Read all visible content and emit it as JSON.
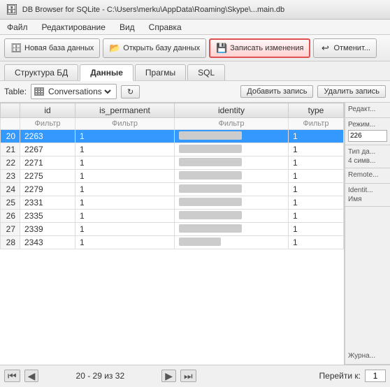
{
  "titlebar": {
    "icon": "🗄",
    "text": "DB Browser for SQLite - C:\\Users\\merku\\AppData\\Roaming\\Skype\\...main.db"
  },
  "menubar": {
    "items": [
      "Файл",
      "Редактирование",
      "Вид",
      "Справка"
    ]
  },
  "toolbar": {
    "new_db": "Новая база данных",
    "open_db": "Открыть базу данных",
    "write_changes": "Записать изменения",
    "cancel": "Отменит..."
  },
  "tabs": [
    "Структура БД",
    "Данные",
    "Прагмы",
    "SQL"
  ],
  "active_tab": 1,
  "table_controls": {
    "label": "Table:",
    "selected_table": "Conversations",
    "refresh_btn": "↻",
    "add_btn": "Добавить запись",
    "del_btn": "Удалить запись"
  },
  "table": {
    "columns": [
      "id",
      "is_permanent",
      "identity",
      "type"
    ],
    "filter_label": "Фильтр",
    "rows": [
      {
        "num": "20",
        "id": "2263",
        "is_permanent": "1",
        "identity": "BLURRED",
        "type": "1",
        "selected": true
      },
      {
        "num": "21",
        "id": "2267",
        "is_permanent": "1",
        "identity": "BLURRED",
        "type": "1",
        "selected": false
      },
      {
        "num": "22",
        "id": "2271",
        "is_permanent": "1",
        "identity": "BLURRED",
        "type": "1",
        "selected": false
      },
      {
        "num": "23",
        "id": "2275",
        "is_permanent": "1",
        "identity": "BLURRED",
        "type": "1",
        "selected": false
      },
      {
        "num": "24",
        "id": "2279",
        "is_permanent": "1",
        "identity": "BLURRED",
        "type": "1",
        "selected": false
      },
      {
        "num": "25",
        "id": "2331",
        "is_permanent": "1",
        "identity": "BLURRED",
        "type": "1",
        "selected": false
      },
      {
        "num": "26",
        "id": "2335",
        "is_permanent": "1",
        "identity": "BLURRED",
        "type": "1",
        "selected": false
      },
      {
        "num": "27",
        "id": "2339",
        "is_permanent": "1",
        "identity": "BLURRED",
        "type": "1",
        "selected": false
      },
      {
        "num": "28",
        "id": "2343",
        "is_permanent": "1",
        "identity": "BLURRED_SHORT",
        "type": "1",
        "selected": false
      }
    ]
  },
  "right_panel": {
    "section1_label": "Редакт...",
    "section2_label": "Режим...",
    "value_226": "226",
    "section3_label": "Тип да...",
    "section3_text": "4 симв...",
    "section4_label": "Remote...",
    "section5_label": "Identit...",
    "section5_text": "Имя",
    "section6_label": "Журна..."
  },
  "statusbar": {
    "range": "20 - 29 из 32",
    "goto_label": "Перейти к:",
    "goto_value": "1"
  }
}
